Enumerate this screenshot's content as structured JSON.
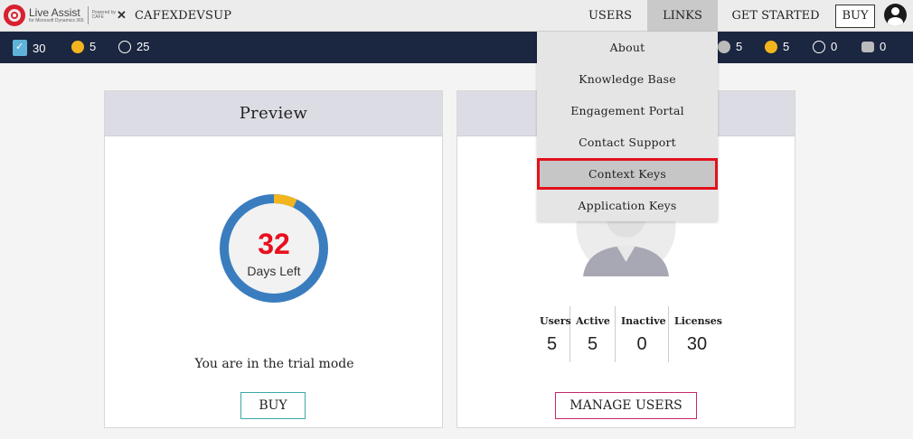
{
  "brand": {
    "name": "Live Assist",
    "subtitle": "for Microsoft Dynamics 365",
    "powered_by": "Powered by",
    "partner": "CAFE"
  },
  "org_name": "CAFEXDEVSUP",
  "nav": {
    "users": "USERS",
    "links": "LINKS",
    "get_started": "GET STARTED",
    "buy": "BUY"
  },
  "status": {
    "left": [
      {
        "icon": "license-book-icon",
        "value": "30"
      },
      {
        "icon": "yellow-dot-icon",
        "value": "5"
      },
      {
        "icon": "empty-circle-icon",
        "value": "25"
      }
    ],
    "right": [
      {
        "icon": "agent-face-icon",
        "value": "5"
      },
      {
        "icon": "yellow-dot-icon",
        "value": "5"
      },
      {
        "icon": "empty-circle-icon",
        "value": "0"
      },
      {
        "icon": "bot-icon",
        "value": "0"
      }
    ]
  },
  "preview_card": {
    "title": "Preview",
    "days_left": "32",
    "days_label": "Days Left",
    "trial_progress": 0.07,
    "trial_text": "You are in the trial mode",
    "buy_label": "BUY",
    "colors": {
      "ring": "#3a7dbf",
      "used": "#f2b51e",
      "number": "#e8101e"
    }
  },
  "users_card": {
    "stats": [
      {
        "label": "Users",
        "value": "5"
      },
      {
        "label": "Active",
        "value": "5"
      },
      {
        "label": "Inactive",
        "value": "0"
      },
      {
        "label": "Licenses",
        "value": "30"
      }
    ],
    "manage_label": "MANAGE USERS"
  },
  "links_menu": {
    "items": [
      {
        "label": "About"
      },
      {
        "label": "Knowledge Base"
      },
      {
        "label": "Engagement Portal"
      },
      {
        "label": "Contact Support"
      },
      {
        "label": "Context Keys"
      },
      {
        "label": "Application Keys"
      }
    ],
    "highlighted_index": 4
  }
}
